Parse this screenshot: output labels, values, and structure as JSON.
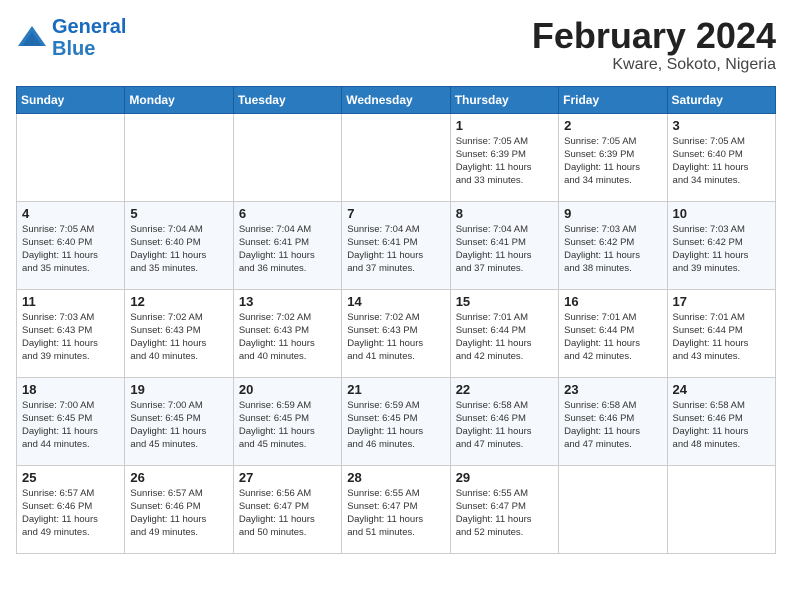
{
  "logo": {
    "brand": "General",
    "brand2": "Blue"
  },
  "title": "February 2024",
  "subtitle": "Kware, Sokoto, Nigeria",
  "weekdays": [
    "Sunday",
    "Monday",
    "Tuesday",
    "Wednesday",
    "Thursday",
    "Friday",
    "Saturday"
  ],
  "weeks": [
    [
      {
        "day": "",
        "info": ""
      },
      {
        "day": "",
        "info": ""
      },
      {
        "day": "",
        "info": ""
      },
      {
        "day": "",
        "info": ""
      },
      {
        "day": "1",
        "info": "Sunrise: 7:05 AM\nSunset: 6:39 PM\nDaylight: 11 hours\nand 33 minutes."
      },
      {
        "day": "2",
        "info": "Sunrise: 7:05 AM\nSunset: 6:39 PM\nDaylight: 11 hours\nand 34 minutes."
      },
      {
        "day": "3",
        "info": "Sunrise: 7:05 AM\nSunset: 6:40 PM\nDaylight: 11 hours\nand 34 minutes."
      }
    ],
    [
      {
        "day": "4",
        "info": "Sunrise: 7:05 AM\nSunset: 6:40 PM\nDaylight: 11 hours\nand 35 minutes."
      },
      {
        "day": "5",
        "info": "Sunrise: 7:04 AM\nSunset: 6:40 PM\nDaylight: 11 hours\nand 35 minutes."
      },
      {
        "day": "6",
        "info": "Sunrise: 7:04 AM\nSunset: 6:41 PM\nDaylight: 11 hours\nand 36 minutes."
      },
      {
        "day": "7",
        "info": "Sunrise: 7:04 AM\nSunset: 6:41 PM\nDaylight: 11 hours\nand 37 minutes."
      },
      {
        "day": "8",
        "info": "Sunrise: 7:04 AM\nSunset: 6:41 PM\nDaylight: 11 hours\nand 37 minutes."
      },
      {
        "day": "9",
        "info": "Sunrise: 7:03 AM\nSunset: 6:42 PM\nDaylight: 11 hours\nand 38 minutes."
      },
      {
        "day": "10",
        "info": "Sunrise: 7:03 AM\nSunset: 6:42 PM\nDaylight: 11 hours\nand 39 minutes."
      }
    ],
    [
      {
        "day": "11",
        "info": "Sunrise: 7:03 AM\nSunset: 6:43 PM\nDaylight: 11 hours\nand 39 minutes."
      },
      {
        "day": "12",
        "info": "Sunrise: 7:02 AM\nSunset: 6:43 PM\nDaylight: 11 hours\nand 40 minutes."
      },
      {
        "day": "13",
        "info": "Sunrise: 7:02 AM\nSunset: 6:43 PM\nDaylight: 11 hours\nand 40 minutes."
      },
      {
        "day": "14",
        "info": "Sunrise: 7:02 AM\nSunset: 6:43 PM\nDaylight: 11 hours\nand 41 minutes."
      },
      {
        "day": "15",
        "info": "Sunrise: 7:01 AM\nSunset: 6:44 PM\nDaylight: 11 hours\nand 42 minutes."
      },
      {
        "day": "16",
        "info": "Sunrise: 7:01 AM\nSunset: 6:44 PM\nDaylight: 11 hours\nand 42 minutes."
      },
      {
        "day": "17",
        "info": "Sunrise: 7:01 AM\nSunset: 6:44 PM\nDaylight: 11 hours\nand 43 minutes."
      }
    ],
    [
      {
        "day": "18",
        "info": "Sunrise: 7:00 AM\nSunset: 6:45 PM\nDaylight: 11 hours\nand 44 minutes."
      },
      {
        "day": "19",
        "info": "Sunrise: 7:00 AM\nSunset: 6:45 PM\nDaylight: 11 hours\nand 45 minutes."
      },
      {
        "day": "20",
        "info": "Sunrise: 6:59 AM\nSunset: 6:45 PM\nDaylight: 11 hours\nand 45 minutes."
      },
      {
        "day": "21",
        "info": "Sunrise: 6:59 AM\nSunset: 6:45 PM\nDaylight: 11 hours\nand 46 minutes."
      },
      {
        "day": "22",
        "info": "Sunrise: 6:58 AM\nSunset: 6:46 PM\nDaylight: 11 hours\nand 47 minutes."
      },
      {
        "day": "23",
        "info": "Sunrise: 6:58 AM\nSunset: 6:46 PM\nDaylight: 11 hours\nand 47 minutes."
      },
      {
        "day": "24",
        "info": "Sunrise: 6:58 AM\nSunset: 6:46 PM\nDaylight: 11 hours\nand 48 minutes."
      }
    ],
    [
      {
        "day": "25",
        "info": "Sunrise: 6:57 AM\nSunset: 6:46 PM\nDaylight: 11 hours\nand 49 minutes."
      },
      {
        "day": "26",
        "info": "Sunrise: 6:57 AM\nSunset: 6:46 PM\nDaylight: 11 hours\nand 49 minutes."
      },
      {
        "day": "27",
        "info": "Sunrise: 6:56 AM\nSunset: 6:47 PM\nDaylight: 11 hours\nand 50 minutes."
      },
      {
        "day": "28",
        "info": "Sunrise: 6:55 AM\nSunset: 6:47 PM\nDaylight: 11 hours\nand 51 minutes."
      },
      {
        "day": "29",
        "info": "Sunrise: 6:55 AM\nSunset: 6:47 PM\nDaylight: 11 hours\nand 52 minutes."
      },
      {
        "day": "",
        "info": ""
      },
      {
        "day": "",
        "info": ""
      }
    ]
  ]
}
